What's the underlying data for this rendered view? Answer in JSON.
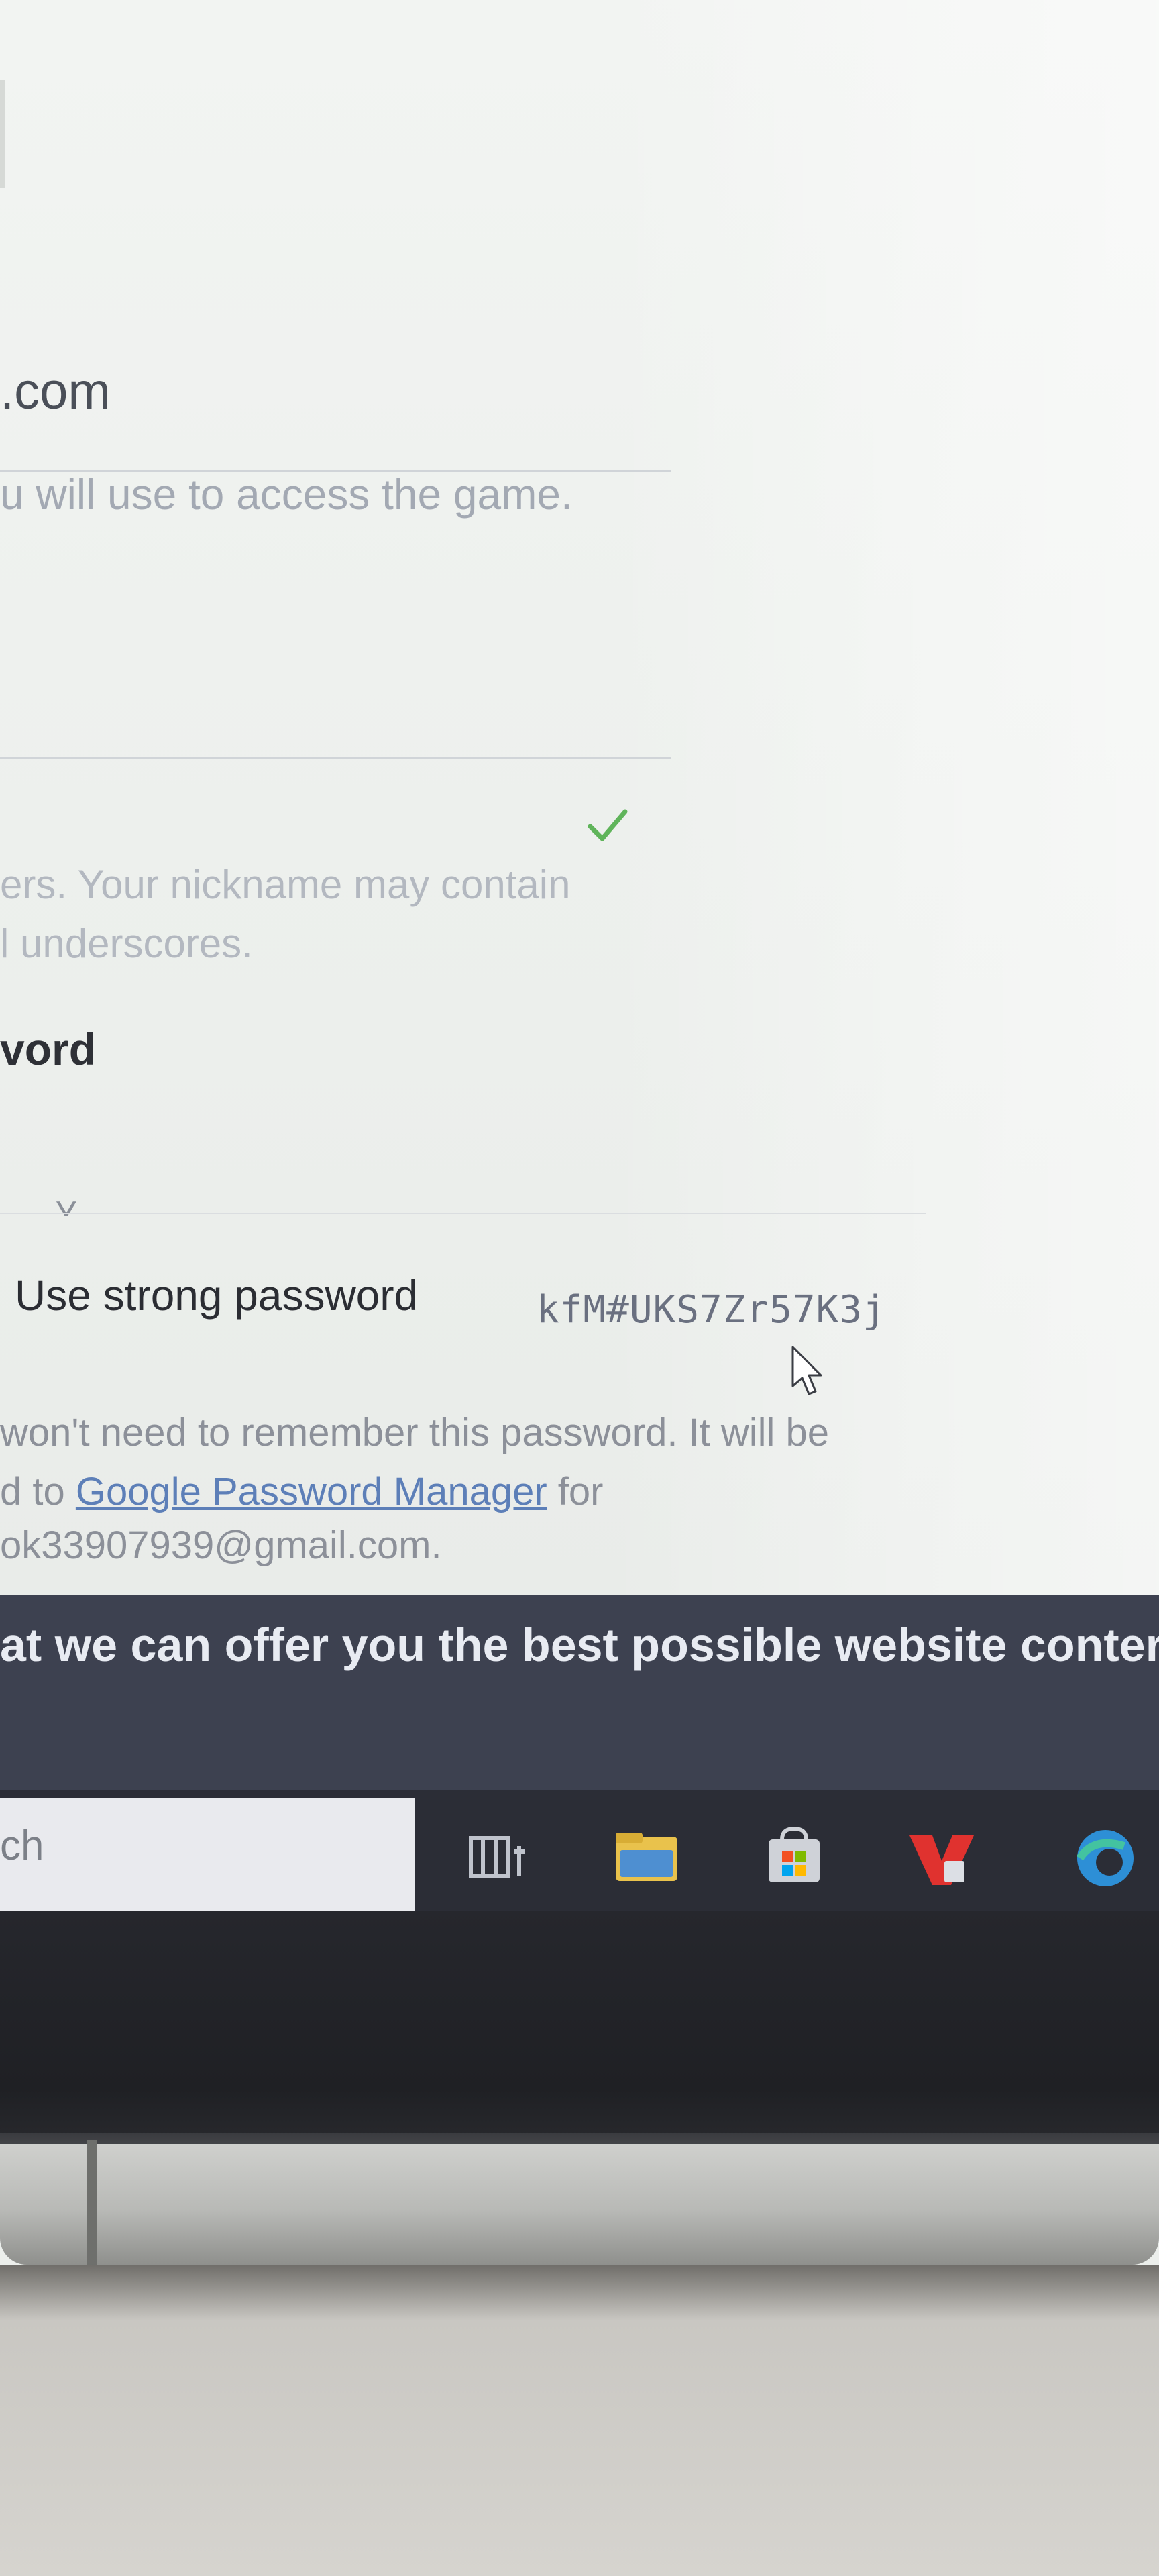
{
  "form": {
    "email_value": ".com",
    "email_hint": "u will use to access the game.",
    "nickname_hint_line1": "ers. Your nickname may contain",
    "nickname_hint_line2": "l underscores.",
    "password_label": "vord",
    "password_suggestion": {
      "label": "Use strong password",
      "generated": "kfM#UKS7Zr57K3j"
    },
    "password_info": {
      "line1": "won't need to remember this password. It will be",
      "line2_prefix": "d to ",
      "line2_link": "Google Password Manager",
      "line2_suffix": " for",
      "line3": "ok33907939@gmail.com."
    }
  },
  "cookie_banner": {
    "text": "at we can offer you the best possible website conter"
  },
  "taskbar": {
    "search_text": "ch",
    "icons": [
      "task-view-icon",
      "file-explorer-icon",
      "store-icon",
      "app-icon",
      "edge-icon"
    ]
  },
  "colors": {
    "check": "#5fb45a",
    "banner": "#3d4150",
    "taskbar": "#2b2d36",
    "link": "#5d7fb8"
  }
}
